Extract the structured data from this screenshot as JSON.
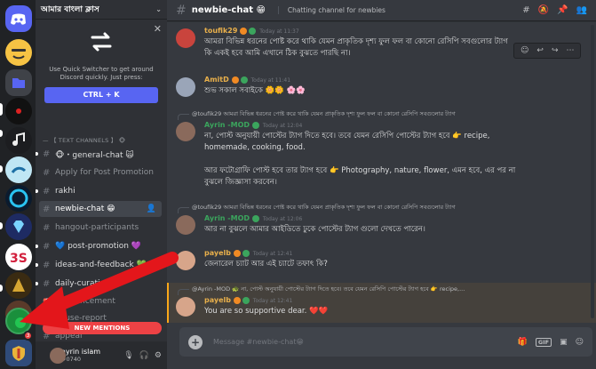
{
  "server": {
    "name": "আমার বাংলা ক্লাস"
  },
  "quick_switcher": {
    "text": "Use Quick Switcher to get around Discord quickly. Just press:",
    "shortcut": "CTRL + K"
  },
  "category": "— 【 TEXT CHANNELS 】 🐵",
  "channels": [
    {
      "name": "🐵・general-chat 🙀",
      "unread": true
    },
    {
      "name": "Apply for Post Promotion",
      "unread": false
    },
    {
      "name": "rakhi",
      "unread": true
    },
    {
      "name": "newbie-chat 😁",
      "unread": false,
      "active": true
    },
    {
      "name": "hangout-participants",
      "unread": false
    },
    {
      "name": "💙 post-promotion 💜",
      "unread": true
    },
    {
      "name": "ideas-and-feedback 💚",
      "unread": true
    },
    {
      "name": "daily-curations",
      "unread": true
    },
    {
      "name": "announcement",
      "unread": false
    },
    {
      "name": "abuse-report",
      "unread": false
    },
    {
      "name": "appeal",
      "unread": false
    }
  ],
  "new_mentions": "NEW MENTIONS",
  "user": {
    "name": "ayrin islam",
    "tag": "#0740"
  },
  "mention_badge": "3",
  "header": {
    "channel": "newbie-chat 😁",
    "topic": "Chatting channel for newbies"
  },
  "messages": [
    {
      "author": "toufik29",
      "color": "#e9b04b",
      "time": "Today at 11:37",
      "lines": [
        "আমরা বিভিন্ন ধরনের পোষ্ট করে থাকি যেমন প্রাকৃতিক দৃশ্য  ফুল ফল বা কোনো রেসিপি সবগুলোর ট্যাগ",
        "কি একই হবে আমি এখানে ঠিক বুঝতে পারছি না।"
      ]
    },
    {
      "author": "AmitD",
      "color": "#e9b04b",
      "time": "Today at 11:41",
      "lines": [
        "শুভ সকাল সবাইকে 🌼🌼 🌸🌸"
      ]
    },
    {
      "reply": "@toufik29 আমরা বিভিন্ন ধরনের পোষ্ট করে থাকি যেমন প্রাকৃতিক দৃশ্য  ফুল ফল বা কোনো রেসিপি  সবগুলোর ট্যাগ",
      "author": "Ayrin -MOD",
      "color": "#3ba55d",
      "time": "Today at 12:04",
      "lines": [
        "না, পোস্ট অনুযায়ী পোস্টের ট্যাগ দিতে হবে। তবে যেমন রেসিপি পোস্টের ট্যাগ হবে 👉 recipe,",
        "homemade, cooking, food.",
        "",
        "আর ফটোগ্রাফি পোস্ট হবে তার ট্যাগ হবে 👉 Photography, nature, flower,  এমন হবে, এর পর না",
        "বুঝলে জিজ্ঞাসা করবেন।"
      ]
    },
    {
      "reply": "@toufik29 আমরা বিভিন্ন ধরনের পোষ্ট করে থাকি যেমন প্রাকৃতিক দৃশ্য  ফুল ফল বা কোনো রেসিপি  সবগুলোর ট্যাগ",
      "author": "Ayrin -MOD",
      "color": "#3ba55d",
      "time": "Today at 12:06",
      "lines": [
        "আর না বুঝলে আমার  আইডিতে ঢুকে পোস্টের ট্যাগ গুলো দেখতে পারেন।"
      ]
    },
    {
      "author": "payelb",
      "color": "#e9b04b",
      "time": "Today at 12:41",
      "lines": [
        "জেনারেল চ্যাট আর এই চ্যাটে তফাৎ কি?"
      ]
    },
    {
      "reply": "@Ayrin -MOD 🐢 না, পোস্ট অনুযায়ী পোস্টের ট্যাগ দিতে হবে। তবে যেমন রেসিপি পোস্টের ট্যাগ হবে 👉 recipe,...",
      "author": "payelb",
      "color": "#e9b04b",
      "time": "Today at 12:41",
      "lines": [
        "You are so supportive dear. ❤️❤️"
      ]
    }
  ],
  "composer": {
    "placeholder": "Message #newbie-chat😁"
  },
  "colors": {
    "accent": "#5865f2",
    "mention": "#ed4245",
    "arrow": "#e3161b"
  }
}
